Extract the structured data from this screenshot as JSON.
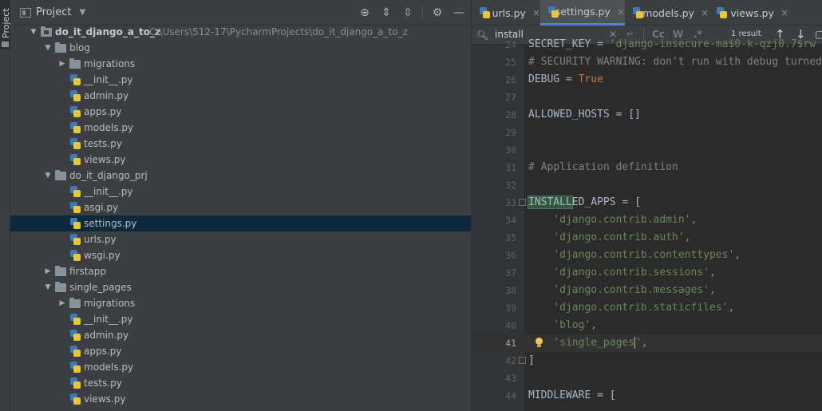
{
  "toolstrip": {
    "project_tab": "Project"
  },
  "project_panel": {
    "title": "Project",
    "tree": [
      {
        "label": "do_it_django_a_to_z",
        "path": "C:\\Users\\512-17\\PycharmProjects\\do_it_django_a_to_z",
        "kind": "root-folder",
        "depth": 0,
        "expanded": true
      },
      {
        "label": "blog",
        "kind": "folder",
        "depth": 1,
        "expanded": true
      },
      {
        "label": "migrations",
        "kind": "folder",
        "depth": 2,
        "expanded": false
      },
      {
        "label": "__init__.py",
        "kind": "py",
        "depth": 2
      },
      {
        "label": "admin.py",
        "kind": "py",
        "depth": 2
      },
      {
        "label": "apps.py",
        "kind": "py",
        "depth": 2
      },
      {
        "label": "models.py",
        "kind": "py",
        "depth": 2
      },
      {
        "label": "tests.py",
        "kind": "py",
        "depth": 2
      },
      {
        "label": "views.py",
        "kind": "py",
        "depth": 2
      },
      {
        "label": "do_it_django_prj",
        "kind": "folder",
        "depth": 1,
        "expanded": true
      },
      {
        "label": "__init__.py",
        "kind": "py",
        "depth": 2
      },
      {
        "label": "asgi.py",
        "kind": "py",
        "depth": 2
      },
      {
        "label": "settings.py",
        "kind": "py",
        "depth": 2,
        "selected": true
      },
      {
        "label": "urls.py",
        "kind": "py",
        "depth": 2
      },
      {
        "label": "wsgi.py",
        "kind": "py",
        "depth": 2
      },
      {
        "label": "firstapp",
        "kind": "folder",
        "depth": 1,
        "expanded": false
      },
      {
        "label": "single_pages",
        "kind": "folder",
        "depth": 1,
        "expanded": true
      },
      {
        "label": "migrations",
        "kind": "folder",
        "depth": 2,
        "expanded": false
      },
      {
        "label": "__init__.py",
        "kind": "py",
        "depth": 2
      },
      {
        "label": "admin.py",
        "kind": "py",
        "depth": 2
      },
      {
        "label": "apps.py",
        "kind": "py",
        "depth": 2
      },
      {
        "label": "models.py",
        "kind": "py",
        "depth": 2
      },
      {
        "label": "tests.py",
        "kind": "py",
        "depth": 2
      },
      {
        "label": "views.py",
        "kind": "py",
        "depth": 2
      }
    ]
  },
  "editor": {
    "tabs": [
      {
        "label": "urls.py",
        "active": false
      },
      {
        "label": "settings.py",
        "active": true
      },
      {
        "label": "models.py",
        "active": false
      },
      {
        "label": "views.py",
        "active": false
      }
    ],
    "find": {
      "query": "install",
      "case_toggle": "Cc",
      "word_toggle": "W",
      "regex_toggle": ".*",
      "results": "1 result"
    },
    "current_line": 41,
    "lines": [
      {
        "n": "24",
        "tokens": [
          {
            "t": "SECRET_KEY = ",
            "c": ""
          },
          {
            "t": "'django-insecure-ma$0-k-qzj0.7$rw",
            "c": "st"
          }
        ]
      },
      {
        "n": "25",
        "tokens": [
          {
            "t": "# SECURITY WARNING: don't run with debug turned on in production!",
            "c": "cm"
          }
        ]
      },
      {
        "n": "26",
        "tokens": [
          {
            "t": "DEBUG = ",
            "c": ""
          },
          {
            "t": "True",
            "c": "kw"
          }
        ]
      },
      {
        "n": "27",
        "tokens": []
      },
      {
        "n": "28",
        "tokens": [
          {
            "t": "ALLOWED_HOSTS = []",
            "c": ""
          }
        ]
      },
      {
        "n": "29",
        "tokens": []
      },
      {
        "n": "30",
        "tokens": []
      },
      {
        "n": "31",
        "tokens": [
          {
            "t": "# Application definition",
            "c": "cm"
          }
        ]
      },
      {
        "n": "32",
        "tokens": []
      },
      {
        "n": "33",
        "tokens": [
          {
            "t": "INSTALL",
            "c": "hl"
          },
          {
            "t": "ED_APPS = [",
            "c": ""
          }
        ]
      },
      {
        "n": "34",
        "tokens": [
          {
            "t": "    ",
            "c": ""
          },
          {
            "t": "'django.contrib.admin'",
            "c": "st"
          },
          {
            "t": ",",
            "c": "kw"
          }
        ]
      },
      {
        "n": "35",
        "tokens": [
          {
            "t": "    ",
            "c": ""
          },
          {
            "t": "'django.contrib.auth'",
            "c": "st"
          },
          {
            "t": ",",
            "c": "kw"
          }
        ]
      },
      {
        "n": "36",
        "tokens": [
          {
            "t": "    ",
            "c": ""
          },
          {
            "t": "'django.contrib.contenttypes'",
            "c": "st"
          },
          {
            "t": ",",
            "c": "kw"
          }
        ]
      },
      {
        "n": "37",
        "tokens": [
          {
            "t": "    ",
            "c": ""
          },
          {
            "t": "'django.contrib.sessions'",
            "c": "st"
          },
          {
            "t": ",",
            "c": "kw"
          }
        ]
      },
      {
        "n": "38",
        "tokens": [
          {
            "t": "    ",
            "c": ""
          },
          {
            "t": "'django.contrib.messages'",
            "c": "st"
          },
          {
            "t": ",",
            "c": "kw"
          }
        ]
      },
      {
        "n": "39",
        "tokens": [
          {
            "t": "    ",
            "c": ""
          },
          {
            "t": "'django.contrib.staticfiles'",
            "c": "st"
          },
          {
            "t": ",",
            "c": "kw"
          }
        ]
      },
      {
        "n": "40",
        "tokens": [
          {
            "t": "    ",
            "c": ""
          },
          {
            "t": "'blog'",
            "c": "st"
          },
          {
            "t": ",",
            "c": "kw"
          }
        ]
      },
      {
        "n": "41",
        "tokens": [
          {
            "t": "    ",
            "c": ""
          },
          {
            "t": "'single_pages",
            "c": "st"
          },
          {
            "t": "|",
            "c": "caret"
          },
          {
            "t": "'",
            "c": "st"
          },
          {
            "t": ",",
            "c": "kw"
          }
        ]
      },
      {
        "n": "42",
        "tokens": [
          {
            "t": "]",
            "c": ""
          }
        ]
      },
      {
        "n": "43",
        "tokens": []
      },
      {
        "n": "44",
        "tokens": [
          {
            "t": "MIDDLEWARE = [",
            "c": ""
          }
        ]
      }
    ]
  },
  "colors": {
    "panel_bg": "#3c3f41",
    "editor_bg": "#2b2b2b",
    "selection": "#0d293e",
    "string": "#6a8759",
    "keyword": "#cc7832",
    "comment": "#808080",
    "match_highlight": "#32593d"
  }
}
